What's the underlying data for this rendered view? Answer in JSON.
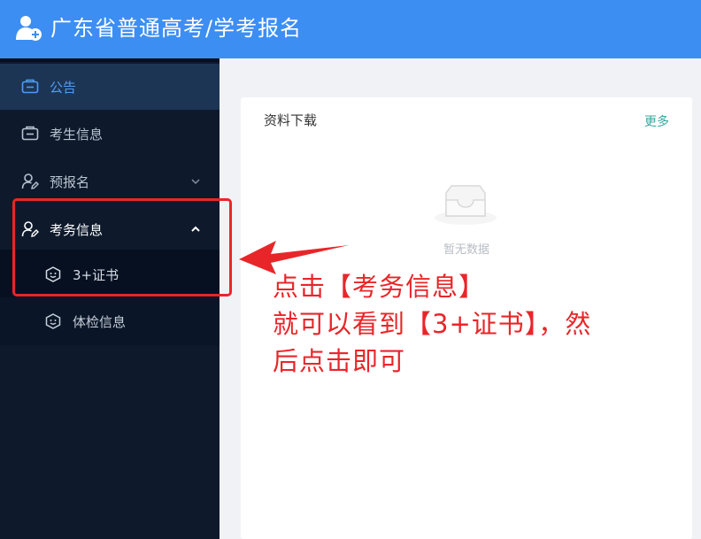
{
  "header": {
    "title": "广东省普通高考/学考报名",
    "logo_icon": "user-add-icon",
    "background": "#3d8ef2"
  },
  "sidebar": {
    "background": "#0e1a2c",
    "items": [
      {
        "label": "公告",
        "icon": "id-card-icon",
        "state": "active"
      },
      {
        "label": "考生信息",
        "icon": "id-card-icon"
      },
      {
        "label": "预报名",
        "icon": "user-edit-icon",
        "expand_icon": "chevron-down-icon",
        "expanded": false
      },
      {
        "label": "考务信息",
        "icon": "user-edit-icon",
        "expand_icon": "chevron-up-icon",
        "expanded": true
      },
      {
        "label": "3+证书",
        "icon": "smiley-icon",
        "level": 2
      },
      {
        "label": "体检信息",
        "icon": "smiley-icon",
        "level": 2
      }
    ]
  },
  "card": {
    "title": "资料下载",
    "more": "更多",
    "empty_text": "暂无数据",
    "empty_icon": "inbox-icon"
  },
  "annotation": {
    "lines": [
      "点击【考务信息】",
      "就可以看到【3+证书】，然",
      "后点击即可"
    ],
    "color": "#e8262a",
    "arrow_icon": "arrow-left-icon"
  }
}
